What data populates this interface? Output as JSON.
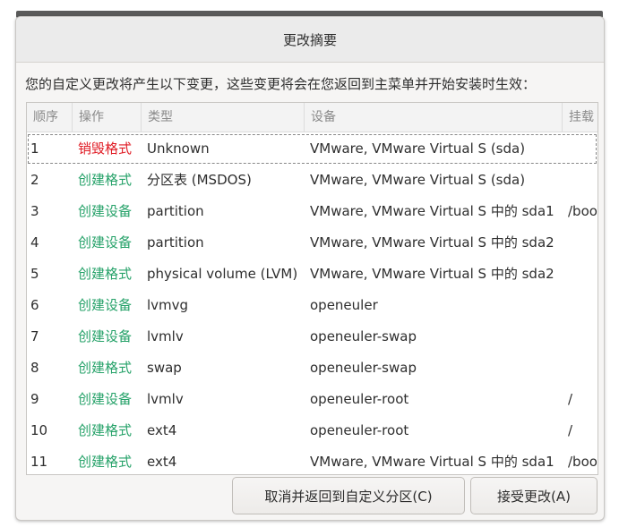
{
  "dialog": {
    "title": "更改摘要",
    "summary": "您的自定义更改将产生以下变更，这些变更将会在您返回到主菜单并开始安装时生效：",
    "columns": [
      "顺序",
      "操作",
      "类型",
      "设备",
      "挂载"
    ],
    "rows": [
      {
        "num": "1",
        "action": "销毁格式",
        "type": "Unknown",
        "device": "VMware, VMware Virtual S (sda)",
        "mount": ""
      },
      {
        "num": "2",
        "action": "创建格式",
        "type": "分区表 (MSDOS)",
        "device": "VMware, VMware Virtual S (sda)",
        "mount": ""
      },
      {
        "num": "3",
        "action": "创建设备",
        "type": "partition",
        "device": "VMware, VMware Virtual S 中的 sda1",
        "mount": "/boot"
      },
      {
        "num": "4",
        "action": "创建设备",
        "type": "partition",
        "device": "VMware, VMware Virtual S 中的 sda2",
        "mount": ""
      },
      {
        "num": "5",
        "action": "创建格式",
        "type": "physical volume (LVM)",
        "device": "VMware, VMware Virtual S 中的 sda2",
        "mount": ""
      },
      {
        "num": "6",
        "action": "创建设备",
        "type": "lvmvg",
        "device": "openeuler",
        "mount": ""
      },
      {
        "num": "7",
        "action": "创建设备",
        "type": "lvmlv",
        "device": "openeuler-swap",
        "mount": ""
      },
      {
        "num": "8",
        "action": "创建格式",
        "type": "swap",
        "device": "openeuler-swap",
        "mount": ""
      },
      {
        "num": "9",
        "action": "创建设备",
        "type": "lvmlv",
        "device": "openeuler-root",
        "mount": "/"
      },
      {
        "num": "10",
        "action": "创建格式",
        "type": "ext4",
        "device": "openeuler-root",
        "mount": "/"
      },
      {
        "num": "11",
        "action": "创建格式",
        "type": "ext4",
        "device": "VMware, VMware Virtual S 中的 sda1",
        "mount": "/boot"
      }
    ],
    "cancel_label": "取消并返回到自定义分区(C)",
    "accept_label": "接受更改(A)"
  },
  "colors": {
    "destroy": "#e01b24",
    "create": "#26a269"
  }
}
